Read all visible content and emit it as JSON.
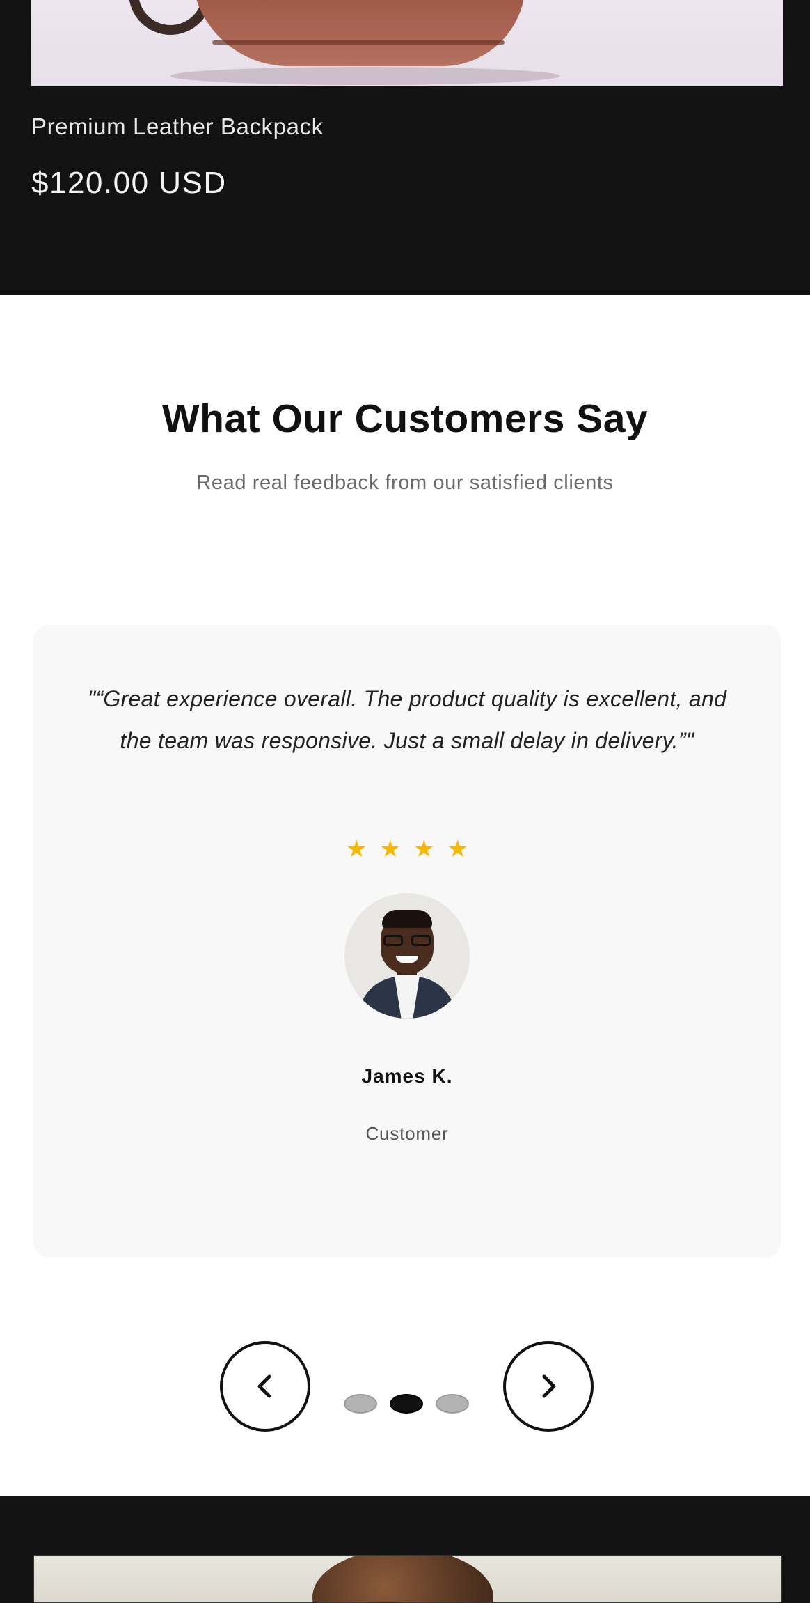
{
  "product": {
    "title": "Premium Leather Backpack",
    "price": "$120.00 USD"
  },
  "testimonials": {
    "heading": "What Our Customers Say",
    "subheading": "Read real feedback from our satisfied clients",
    "current": {
      "quote": "\"“Great experience overall. The product quality is excellent, and the team was responsive. Just a small delay in delivery.”\"",
      "rating": 4,
      "star_glyph": "★",
      "name": "James K.",
      "role": "Customer"
    },
    "pagination": {
      "total": 3,
      "active_index": 1
    },
    "controls": {
      "prev_icon": "chevron-left-icon",
      "next_icon": "chevron-right-icon"
    }
  },
  "colors": {
    "dark_section": "#121212",
    "star": "#f5b800",
    "card_bg": "#f8f8f8",
    "dot_active": "#111111",
    "dot_inactive": "#b3b3b3"
  }
}
